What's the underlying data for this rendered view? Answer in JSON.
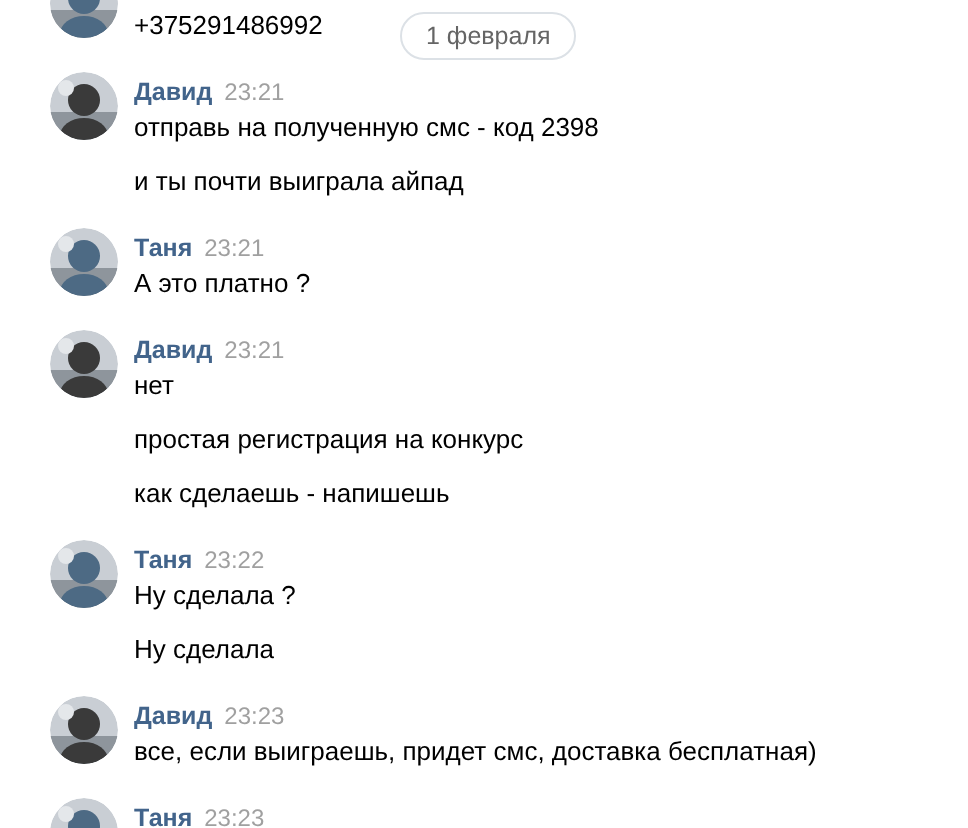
{
  "date_divider": "1 февраля",
  "groups": [
    {
      "color": "#4d6a84",
      "messages": [
        "+375291486992"
      ]
    },
    {
      "author": "Давид",
      "time": "23:21",
      "color": "#3a3a3a",
      "messages": [
        "отправь на полученную смс - код 2398",
        "и ты почти выиграла айпад"
      ]
    },
    {
      "author": "Таня",
      "time": "23:21",
      "color": "#4d6a84",
      "messages": [
        "А это платно ?"
      ]
    },
    {
      "author": "Давид",
      "time": "23:21",
      "color": "#3a3a3a",
      "messages": [
        "нет",
        "простая регистрация на конкурс",
        "как сделаешь - напишешь"
      ]
    },
    {
      "author": "Таня",
      "time": "23:22",
      "color": "#4d6a84",
      "messages": [
        "Ну сделала ?",
        "Ну сделала"
      ]
    },
    {
      "author": "Давид",
      "time": "23:23",
      "color": "#3a3a3a",
      "messages": [
        "все, если выиграешь, придет смс, доставка бесплатная)"
      ]
    },
    {
      "author": "Таня",
      "time": "23:23",
      "color": "#4d6a84"
    }
  ]
}
